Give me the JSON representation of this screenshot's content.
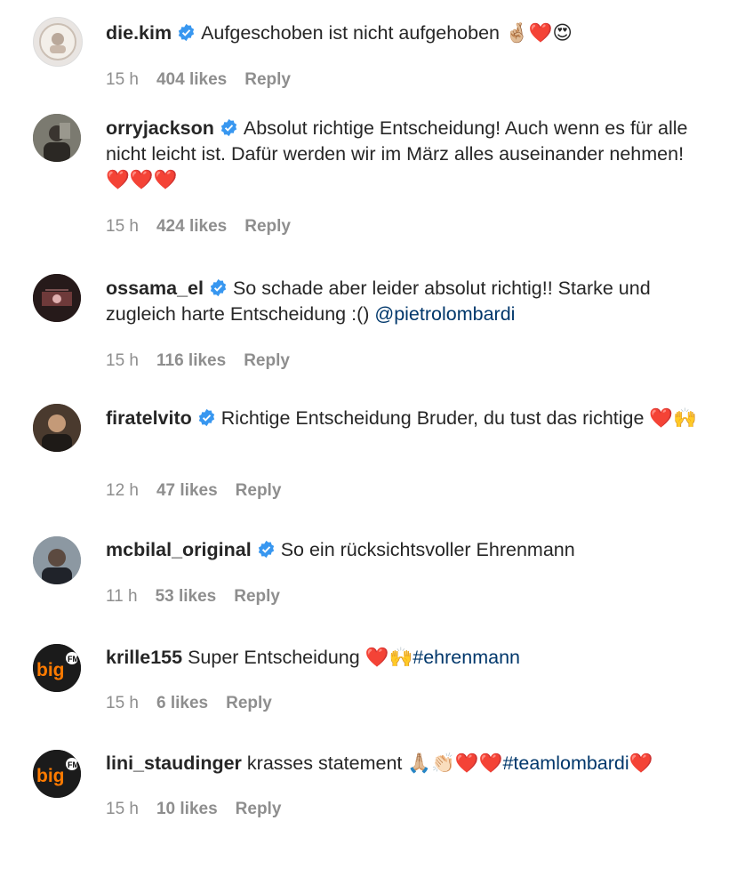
{
  "comments": [
    {
      "user": "die.kim",
      "verified": true,
      "text": "Aufgeschoben ist nicht aufgehoben ",
      "emoji": "🤞🏼❤️😍",
      "mention": "",
      "time": "15 h",
      "likes": "404 likes",
      "reply": "Reply"
    },
    {
      "user": "orryjackson",
      "verified": true,
      "text": "Absolut richtige Entscheidung! Auch wenn es für alle nicht leicht ist. Dafür werden wir im März alles auseinander nehmen! ",
      "emoji": "❤️❤️❤️",
      "mention": "",
      "time": "15 h",
      "likes": "424 likes",
      "reply": "Reply"
    },
    {
      "user": "ossama_el",
      "verified": true,
      "text": "So schade aber leider absolut richtig!! Starke und zugleich harte Entscheidung :() ",
      "emoji": "",
      "mention": "@pietrolombardi",
      "time": "15 h",
      "likes": "116 likes",
      "reply": "Reply"
    },
    {
      "user": "firatelvito",
      "verified": true,
      "text": "Richtige Entscheidung Bruder, du tust das richtige ",
      "emoji": "❤️🙌",
      "mention": "",
      "time": "12 h",
      "likes": "47 likes",
      "reply": "Reply"
    },
    {
      "user": "mcbilal_original",
      "verified": true,
      "text": "So ein rücksichtsvoller Ehrenmann",
      "emoji": "",
      "mention": "",
      "time": "11 h",
      "likes": "53 likes",
      "reply": "Reply"
    },
    {
      "user": "krille155",
      "verified": false,
      "text": "Super Entscheidung ",
      "emoji": "❤️🙌",
      "mention": "#ehrenmann",
      "time": "15 h",
      "likes": "6 likes",
      "reply": "Reply"
    },
    {
      "user": "lini_staudinger",
      "verified": false,
      "text": "krasses statement ",
      "emoji": "🙏🏼👏🏻❤️❤️",
      "mention": "#teamlombardi",
      "emoji2": "❤️",
      "time": "15 h",
      "likes": "10 likes",
      "reply": "Reply"
    }
  ],
  "avatars": {
    "bigfm_label": "big"
  },
  "colors": {
    "text": "#262626",
    "meta": "#8e8e8e",
    "link": "#00376b",
    "verified": "#3897f0"
  }
}
